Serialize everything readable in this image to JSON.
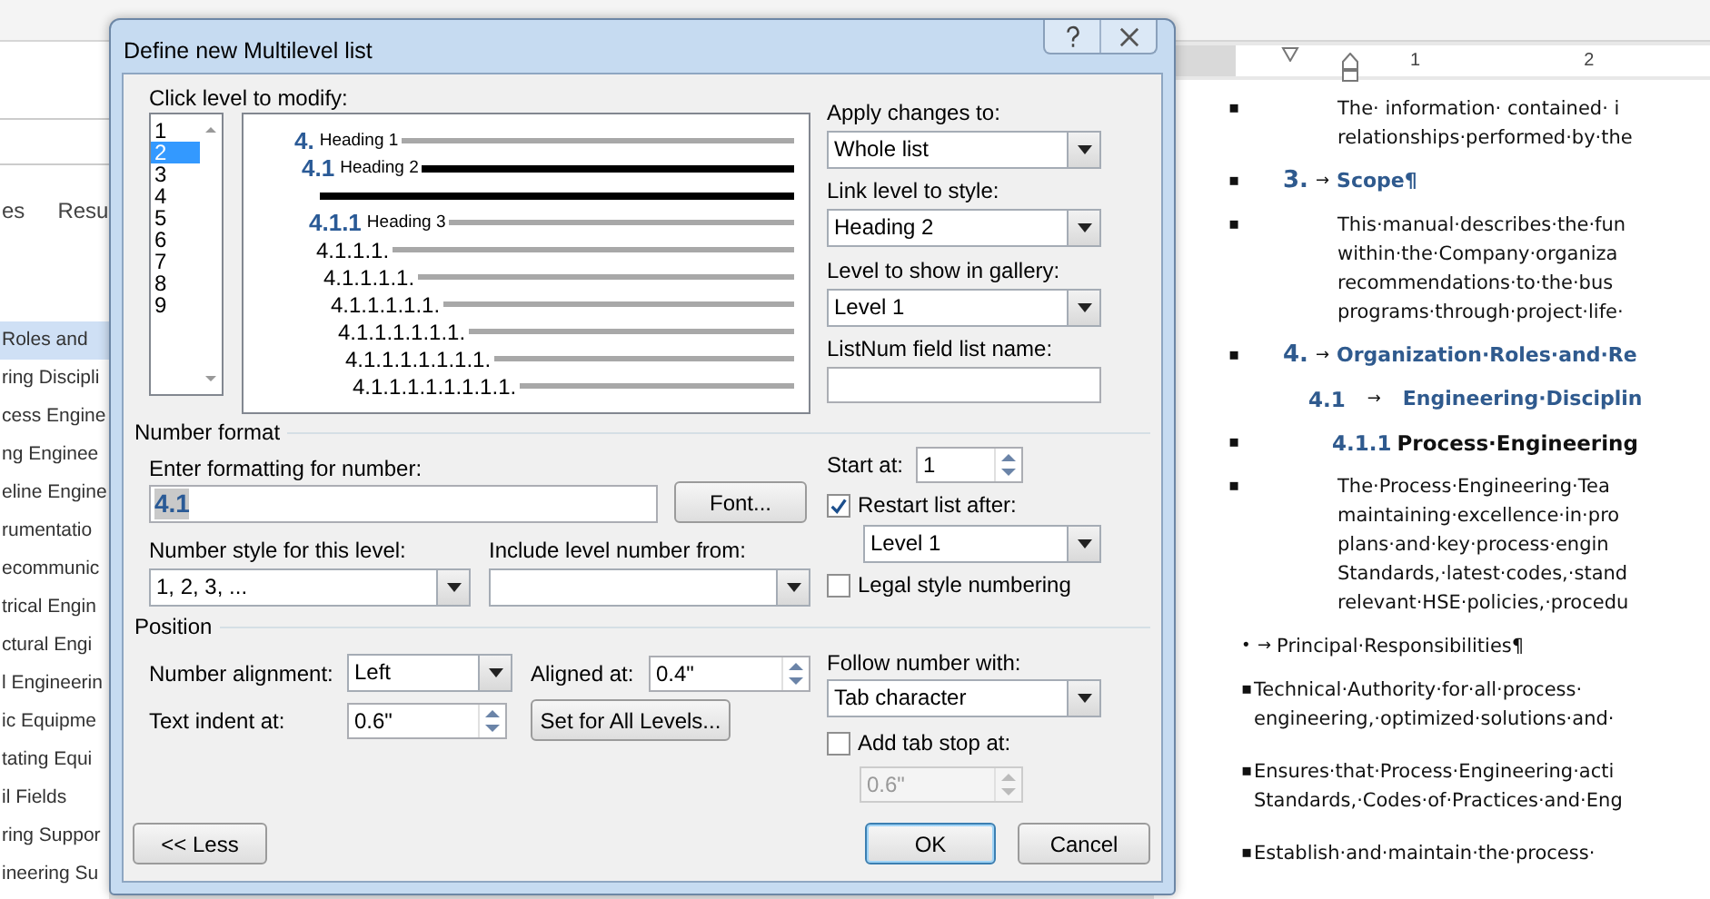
{
  "app": {
    "nav": {
      "tabs": [
        {
          "label": "es",
          "selected": false
        },
        {
          "label": "Resu",
          "selected": false
        }
      ],
      "headings": [
        {
          "label": "Roles and",
          "selected": true
        },
        {
          "label": "ring Discipli",
          "selected": false
        },
        {
          "label": "cess Engine",
          "selected": false
        },
        {
          "label": "ng Enginee",
          "selected": false
        },
        {
          "label": "eline Engine",
          "selected": false
        },
        {
          "label": "rumentatio",
          "selected": false
        },
        {
          "label": "ecommunic",
          "selected": false
        },
        {
          "label": "trical Engin",
          "selected": false
        },
        {
          "label": "ctural Engi",
          "selected": false
        },
        {
          "label": "l Engineerin",
          "selected": false
        },
        {
          "label": "ic Equipme",
          "selected": false
        },
        {
          "label": "tating Equi",
          "selected": false
        },
        {
          "label": "il Fields",
          "selected": false
        },
        {
          "label": "ring Suppor",
          "selected": false
        },
        {
          "label": "ineering Su",
          "selected": false
        }
      ]
    },
    "ruler": {
      "labels": [
        "1",
        "2"
      ]
    },
    "document": {
      "items": [
        {
          "kind": "body",
          "bullet": "▪",
          "lines": [
            "The· information· contained· i",
            "relationships·performed·by·the"
          ]
        },
        {
          "kind": "h1",
          "bullet": "▪",
          "number": "3.",
          "tab": "→",
          "title": "Scope¶"
        },
        {
          "kind": "body",
          "bullet": "▪",
          "lines": [
            "This·manual·describes·the·fun",
            "within·the·Company·organiza",
            "recommendations·to·the·bus",
            "programs·through·project·life·"
          ]
        },
        {
          "kind": "h1",
          "bullet": "▪",
          "number": "4.",
          "tab": "→",
          "title": "Organization·Roles·and·Re"
        },
        {
          "kind": "h2",
          "number": "4.1",
          "tab": "→",
          "title": "Engineering·Disciplin"
        },
        {
          "kind": "h3",
          "bullet": "▪",
          "number": "4.1.1",
          "title": "Process·Engineering"
        },
        {
          "kind": "body",
          "bullet": "▪",
          "lines": [
            "The·Process·Engineering·Tea",
            "maintaining·excellence·in·pro",
            "plans·and·key·process·engin",
            "Standards,·latest·codes,·stand",
            "relevant·HSE·policies,·procedu"
          ]
        },
        {
          "kind": "sub",
          "bullet": "•",
          "tab": "→",
          "lines": [
            "Principal·Responsibilities¶"
          ]
        },
        {
          "kind": "list",
          "bullet": "▪",
          "lines": [
            "Technical·Authority·for·all·process·",
            "engineering,·optimized·solutions·and·"
          ]
        },
        {
          "kind": "list",
          "bullet": "▪",
          "lines": [
            "Ensures·that·Process·Engineering·acti",
            "Standards,·Codes·of·Practices·and·Eng"
          ]
        },
        {
          "kind": "list",
          "bullet": "▪",
          "lines": [
            "Establish·and·maintain·the·process·"
          ]
        }
      ]
    }
  },
  "dialog": {
    "title": "Define new Multilevel list",
    "level_picker": {
      "label": "Click level to modify:",
      "levels": [
        {
          "label": "1",
          "selected": false
        },
        {
          "label": "2",
          "selected": true
        },
        {
          "label": "3",
          "selected": false
        },
        {
          "label": "4",
          "selected": false
        },
        {
          "label": "5",
          "selected": false
        },
        {
          "label": "6",
          "selected": false
        },
        {
          "label": "7",
          "selected": false
        },
        {
          "label": "8",
          "selected": false
        },
        {
          "label": "9",
          "selected": false
        }
      ]
    },
    "preview": {
      "rows": [
        {
          "kind": "heading",
          "number": "4.",
          "style": "Heading 1",
          "selected": false
        },
        {
          "kind": "heading",
          "number": "4.1",
          "style": "Heading 2",
          "selected": true
        },
        {
          "kind": "heading",
          "number": "4.1.1",
          "style": "Heading 3",
          "selected": false
        },
        {
          "kind": "plain",
          "number": "4.1.1.1.",
          "selected": false
        },
        {
          "kind": "plain",
          "number": "4.1.1.1.1.",
          "selected": false
        },
        {
          "kind": "plain",
          "number": "4.1.1.1.1.1.",
          "selected": false
        },
        {
          "kind": "plain",
          "number": "4.1.1.1.1.1.1.",
          "selected": false
        },
        {
          "kind": "plain",
          "number": "4.1.1.1.1.1.1.1.",
          "selected": false
        },
        {
          "kind": "plain",
          "number": "4.1.1.1.1.1.1.1.1.",
          "selected": false
        }
      ]
    },
    "apply_changes": {
      "label": "Apply changes to:",
      "value": "Whole list"
    },
    "link_level": {
      "label": "Link level to style:",
      "value": "Heading 2"
    },
    "gallery_level": {
      "label": "Level to show in gallery:",
      "value": "Level 1"
    },
    "listnum": {
      "label": "ListNum field list name:"
    },
    "number_format": {
      "legend": "Number format",
      "format_label": "Enter formatting for number:",
      "format_value": "4.1",
      "font_button": "Font...",
      "style_label": "Number style for this level:",
      "style_value": "1, 2, 3, ...",
      "include_label": "Include level number from:",
      "start_label": "Start at:",
      "start_value": "1",
      "restart": {
        "label": "Restart list after:",
        "checked": true
      },
      "restart_value": "Level 1",
      "legal": {
        "label": "Legal style numbering",
        "checked": false
      }
    },
    "position": {
      "legend": "Position",
      "alignment_label": "Number alignment:",
      "alignment_value": "Left",
      "aligned_label": "Aligned at:",
      "aligned_value": "0.4\"",
      "indent_label": "Text indent at:",
      "indent_value": "0.6\"",
      "set_all_button": "Set for All Levels...",
      "follow_label": "Follow number with:",
      "follow_value": "Tab character",
      "add_tab": {
        "label": "Add tab stop at:",
        "checked": false
      },
      "tab_stop_value": "0.6\"",
      "tab_stop_disabled": true
    },
    "buttons": [
      {
        "label": "<< Less",
        "default": false
      },
      {
        "label": "OK",
        "default": true
      },
      {
        "label": "Cancel",
        "default": false
      }
    ]
  }
}
